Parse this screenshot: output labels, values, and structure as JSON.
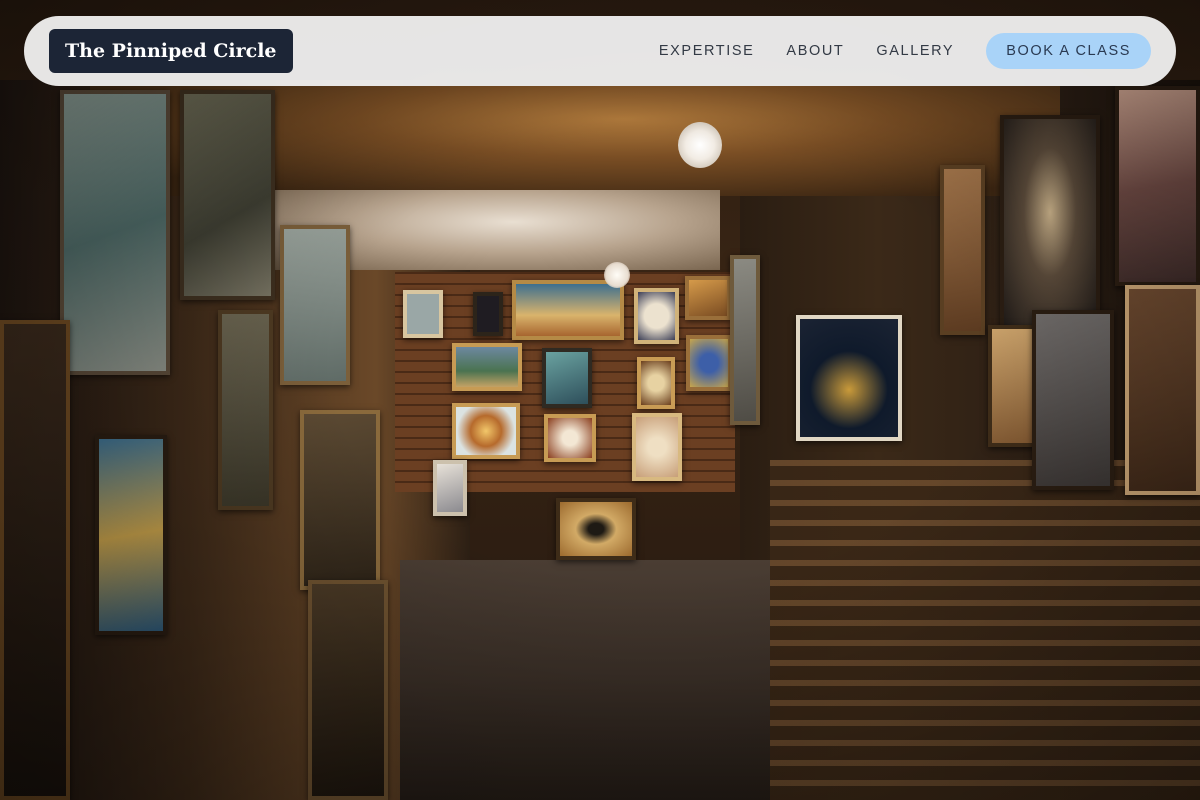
{
  "navbar": {
    "brand": "The Pinniped Circle",
    "links": [
      {
        "label": "EXPERTISE"
      },
      {
        "label": "ABOUT"
      },
      {
        "label": "GALLERY"
      }
    ],
    "cta_label": "BOOK A CLASS"
  },
  "hero": {
    "image": "art-gallery-storeroom-photo"
  },
  "colors": {
    "brand_bg": "#1c2536",
    "cta_bg": "#a9d3f8",
    "nav_bg": "#f5f5f5"
  }
}
